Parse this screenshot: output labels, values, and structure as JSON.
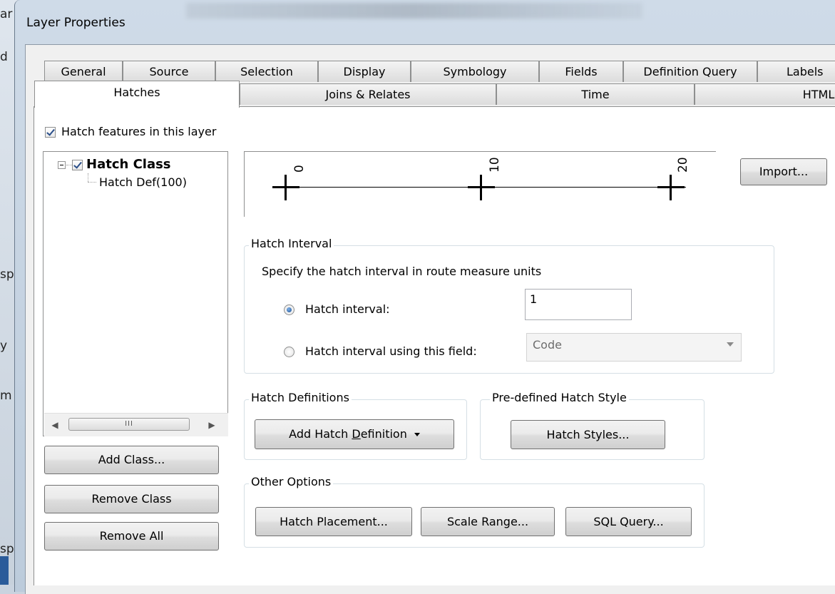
{
  "background_app": {
    "edge_chars": [
      "ar",
      "d",
      "sp",
      "y",
      "m",
      "sp"
    ]
  },
  "window": {
    "title": "Layer Properties"
  },
  "tabs": {
    "row_back": [
      {
        "label": "General"
      },
      {
        "label": "Source"
      },
      {
        "label": "Selection"
      },
      {
        "label": "Display"
      },
      {
        "label": "Symbology"
      },
      {
        "label": "Fields"
      },
      {
        "label": "Definition Query"
      },
      {
        "label": "Labels"
      }
    ],
    "row_front": [
      {
        "label": "Hatches",
        "active": true
      },
      {
        "label": "Joins & Relates"
      },
      {
        "label": "Time"
      },
      {
        "label": "HTML P"
      }
    ]
  },
  "hatch_features_checkbox": {
    "label": "Hatch features in this layer",
    "checked": true
  },
  "tree": {
    "class": {
      "label": "Hatch Class",
      "checked": true
    },
    "definition": {
      "label": "Hatch Def(100)"
    },
    "scrollbar": {
      "thumb_label": "III",
      "left_arrow": "◀",
      "right_arrow": "▶"
    }
  },
  "class_buttons": {
    "add": "Add Class...",
    "remove": "Remove Class",
    "remove_all": "Remove All"
  },
  "preview": {
    "tick_labels": [
      "0",
      "10",
      "20"
    ]
  },
  "import_button": "Import...",
  "hatch_interval": {
    "legend": "Hatch Interval",
    "description": "Specify the hatch interval in route measure units",
    "option_interval": {
      "label": "Hatch interval:",
      "selected": true,
      "value": "1"
    },
    "option_field": {
      "label": "Hatch interval using this field:",
      "selected": false,
      "value": "Code"
    }
  },
  "hatch_definitions": {
    "legend": "Hatch Definitions",
    "add_button": {
      "before": "Add Hatch ",
      "underlined": "D",
      "after": "efinition"
    }
  },
  "predefined_style": {
    "legend": "Pre-defined Hatch Style",
    "button": "Hatch Styles..."
  },
  "other_options": {
    "legend": "Other Options",
    "placement": "Hatch Placement...",
    "scale_range": "Scale Range...",
    "sql_query": "SQL Query..."
  },
  "colors": {
    "frame": "#c4d1df",
    "panel": "#ffffff",
    "radio_selected": "#1c4f92"
  }
}
